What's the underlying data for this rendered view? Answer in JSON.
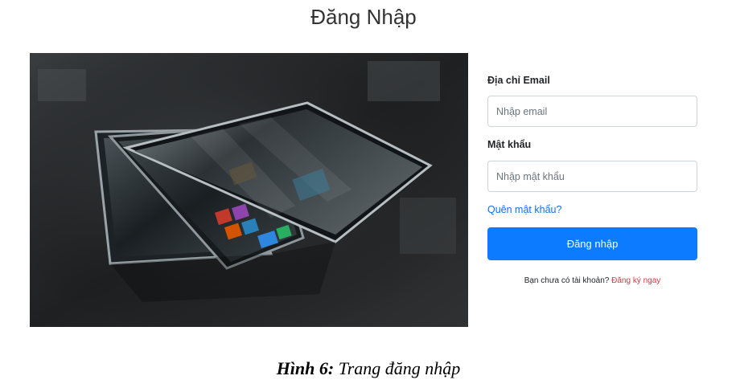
{
  "page": {
    "title": "Đăng Nhập"
  },
  "hero_image": {
    "description_icon": "tablets-photo"
  },
  "form": {
    "email": {
      "label": "Địa chỉ Email",
      "placeholder": "Nhập email",
      "value": ""
    },
    "password": {
      "label": "Mật khẩu",
      "placeholder": "Nhập mật khẩu",
      "value": ""
    },
    "forgot_link": "Quên mật khẩu?",
    "submit_label": "Đăng nhập",
    "signup_prompt": "Bạn chưa có tài khoản?",
    "signup_link": "Đăng ký ngay"
  },
  "caption": {
    "label": "Hình 6:",
    "text": "Trang đăng nhập"
  },
  "colors": {
    "primary": "#0d7bff",
    "link": "#0d6efd",
    "signup_link": "#dc3545"
  }
}
